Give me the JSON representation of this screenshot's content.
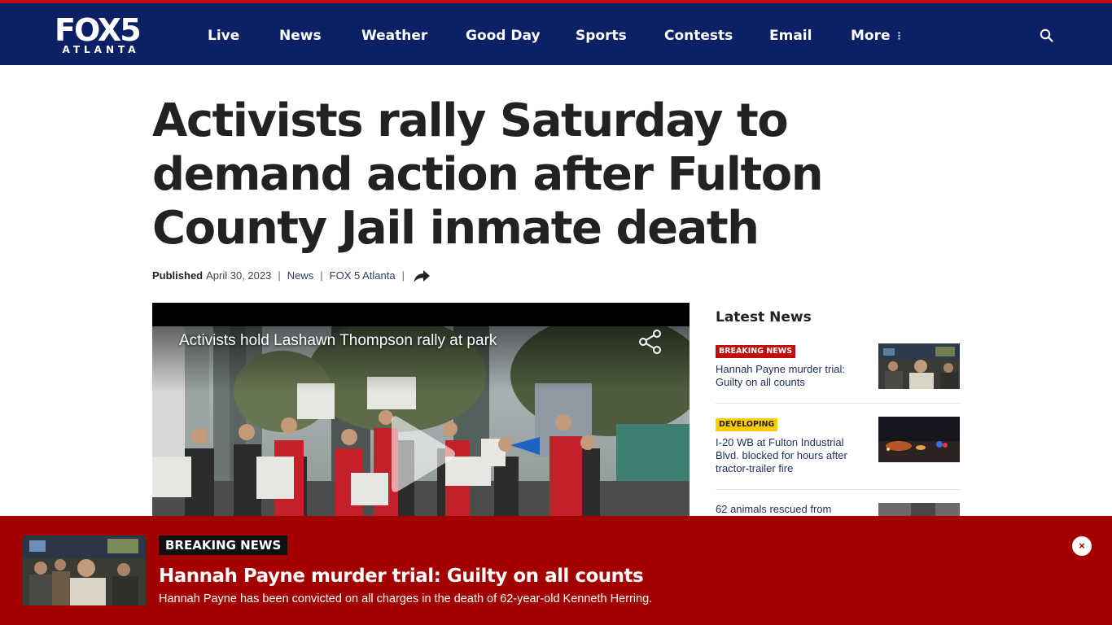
{
  "site": {
    "logo_main": "FOX5",
    "logo_sub": "ATLANTA",
    "nav": [
      "Live",
      "News",
      "Weather",
      "Good Day",
      "Sports",
      "Contests",
      "Email",
      "More"
    ],
    "icons": {
      "search": "search-icon",
      "more": "vertical-dots-icon"
    },
    "colors": {
      "header": "#0c2165",
      "accent": "#c00d0d",
      "banner": "#a30000"
    }
  },
  "article": {
    "headline": "Activists rally Saturday to demand action after Fulton County Jail inmate death",
    "published_label": "Published",
    "date": "April 30, 2023",
    "category": "News",
    "source": "FOX 5 Atlanta"
  },
  "video": {
    "title": "Activists hold Lashawn Thompson rally at park"
  },
  "sidebar": {
    "title": "Latest News",
    "items": [
      {
        "badge": "BREAKING NEWS",
        "text": "Hannah Payne murder trial: Guilty on all counts"
      },
      {
        "badge": "DEVELOPING",
        "text": "I-20 WB at Fulton Industrial Blvd. blocked for hours after tractor-trailer fire"
      },
      {
        "badge": "",
        "text": "62 animals rescued from"
      }
    ]
  },
  "breaking_banner": {
    "badge": "BREAKING NEWS",
    "title": "Hannah Payne murder trial: Guilty on all counts",
    "subtitle": "Hannah Payne has been convicted on all charges in the death of 62-year-old Kenneth Herring.",
    "close": "×"
  }
}
